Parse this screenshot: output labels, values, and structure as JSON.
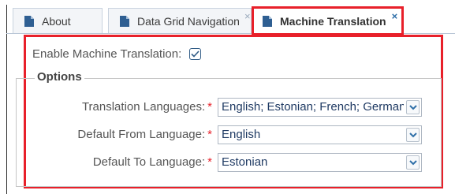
{
  "tabs": [
    {
      "label": "About",
      "closable": false,
      "active": false
    },
    {
      "label": "Data Grid Navigation",
      "closable": true,
      "close_glyph": "×",
      "active": false
    },
    {
      "label": "Machine Translation",
      "closable": true,
      "close_glyph": "×",
      "active": true
    }
  ],
  "panel": {
    "enable_label": "Enable Machine Translation:",
    "enable_checked": true,
    "options_legend": "Options",
    "fields": [
      {
        "label": "Translation Languages:",
        "required_mark": "*",
        "value": "English; Estonian; French; German"
      },
      {
        "label": "Default From Language:",
        "required_mark": "*",
        "value": "English"
      },
      {
        "label": "Default To Language:",
        "required_mark": "*",
        "value": "Estonian"
      }
    ]
  },
  "colors": {
    "highlight": "#e8202a",
    "accent": "#2f6fa8",
    "value_text": "#1f3a63"
  },
  "icons": {
    "tab": "document-icon",
    "dropdown": "chevron-down-icon",
    "checkbox": "checkmark-icon"
  }
}
